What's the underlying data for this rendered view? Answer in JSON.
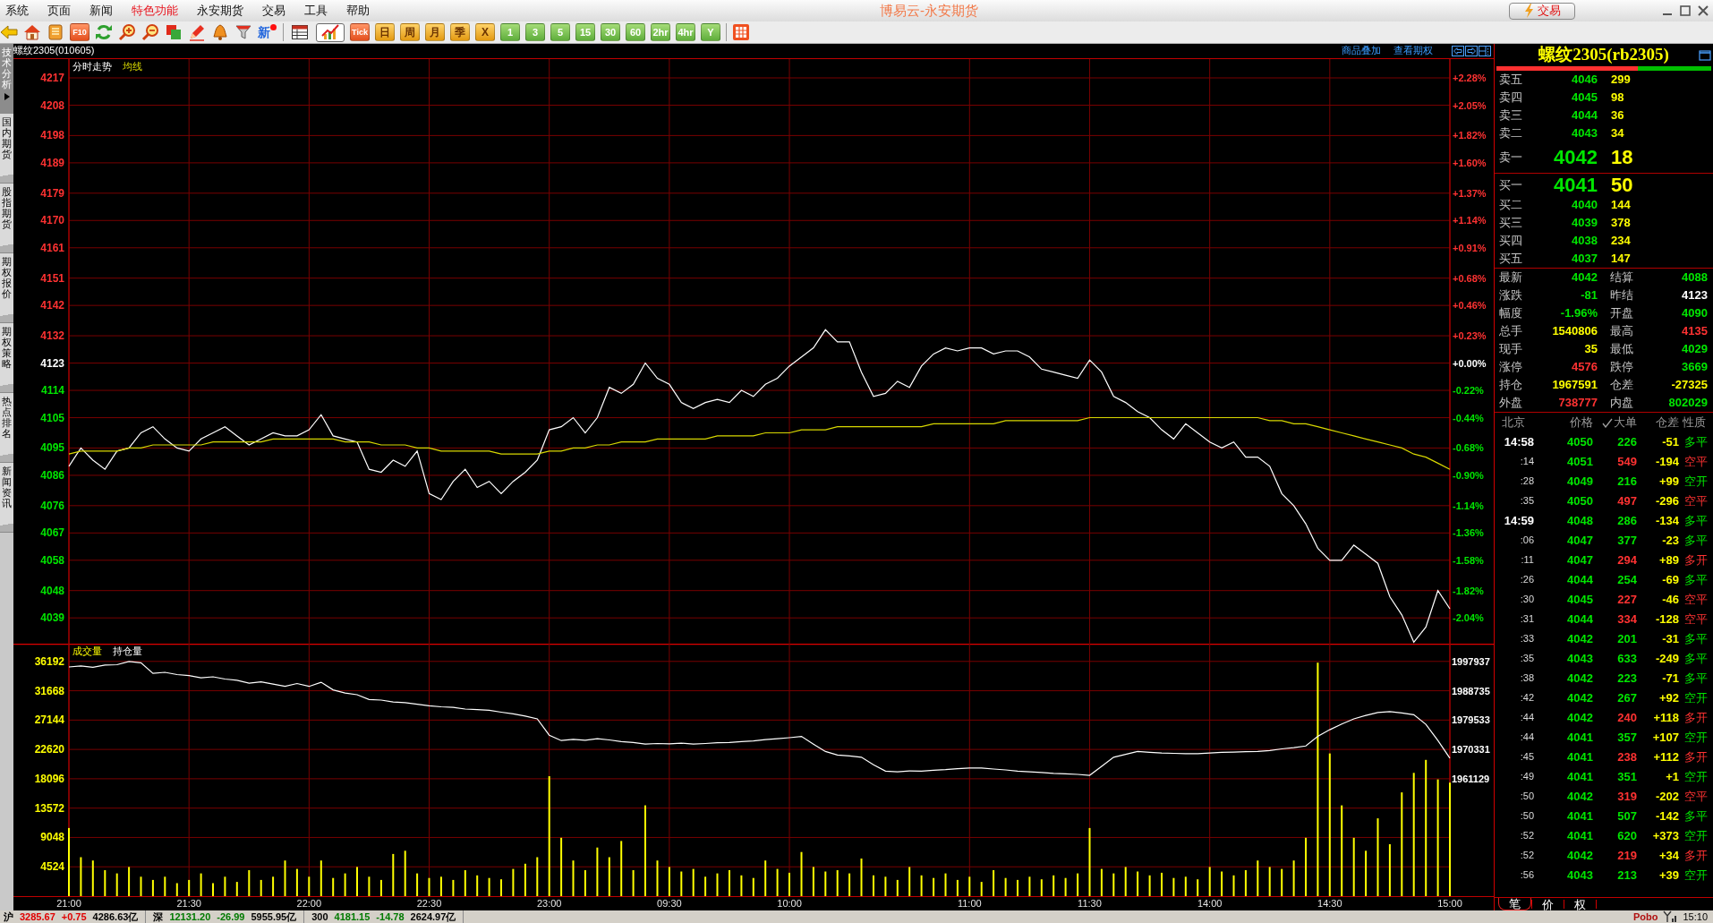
{
  "window": {
    "title": "博易云-永安期货"
  },
  "menu": [
    {
      "label": "系统",
      "highlighted": false
    },
    {
      "label": "页面",
      "highlighted": false
    },
    {
      "label": "新闻",
      "highlighted": false
    },
    {
      "label": "特色功能",
      "highlighted": true
    },
    {
      "label": "永安期货",
      "highlighted": false
    },
    {
      "label": "交易",
      "highlighted": false
    },
    {
      "label": "工具",
      "highlighted": false
    },
    {
      "label": "帮助",
      "highlighted": false
    }
  ],
  "title_buttons": [
    {
      "label": "交易"
    }
  ],
  "toolbar": {
    "f10": "F10",
    "news": {
      "label": "新",
      "badge": true
    },
    "views": [
      {
        "selected": false
      },
      {
        "selected": true
      }
    ],
    "periods": [
      {
        "label": "Tick",
        "kind": "tick"
      },
      {
        "label": "日",
        "kind": "day"
      },
      {
        "label": "周",
        "kind": "day"
      },
      {
        "label": "月",
        "kind": "day"
      },
      {
        "label": "季",
        "kind": "day"
      },
      {
        "label": "X",
        "kind": "day"
      },
      {
        "label": "1",
        "kind": "minute"
      },
      {
        "label": "3",
        "kind": "minute"
      },
      {
        "label": "5",
        "kind": "minute"
      },
      {
        "label": "15",
        "kind": "minute"
      },
      {
        "label": "30",
        "kind": "minute"
      },
      {
        "label": "60",
        "kind": "minute"
      },
      {
        "label": "2hr",
        "kind": "minute"
      },
      {
        "label": "4hr",
        "kind": "minute"
      },
      {
        "label": "Y",
        "kind": "minute"
      }
    ]
  },
  "side_tabs": [
    {
      "label": "技术分析",
      "selected": true
    },
    {
      "label": "国内期货",
      "selected": false
    },
    {
      "label": "股指期货",
      "selected": false
    },
    {
      "label": "期权报价",
      "selected": false
    },
    {
      "label": "期权策略",
      "selected": false
    },
    {
      "label": "热点排名",
      "selected": false
    },
    {
      "label": "新闻资讯",
      "selected": false
    }
  ],
  "chart_header": {
    "title": "螺纹2305(010605)",
    "links": [
      "商品叠加",
      "查看期权"
    ]
  },
  "price_panel": {
    "axis_right": [
      {
        "text": "+2.28%",
        "color": "#ff3232"
      },
      {
        "text": "+2.05%",
        "color": "#ff3232"
      },
      {
        "text": "+1.82%",
        "color": "#ff3232"
      },
      {
        "text": "+1.60%",
        "color": "#ff3232"
      },
      {
        "text": "+1.37%",
        "color": "#ff3232"
      },
      {
        "text": "+1.14%",
        "color": "#ff3232"
      },
      {
        "text": "+0.91%",
        "color": "#ff3232"
      },
      {
        "text": "+0.68%",
        "color": "#ff3232"
      },
      {
        "text": "+0.46%",
        "color": "#ff3232"
      },
      {
        "text": "+0.23%",
        "color": "#ff3232"
      },
      {
        "text": "+0.00%",
        "color": "#ffffff"
      },
      {
        "text": "-0.22%",
        "color": "#00e600"
      },
      {
        "text": "-0.44%",
        "color": "#00e600"
      },
      {
        "text": "-0.68%",
        "color": "#00e600"
      },
      {
        "text": "-0.90%",
        "color": "#00e600"
      },
      {
        "text": "-1.14%",
        "color": "#00e600"
      },
      {
        "text": "-1.36%",
        "color": "#00e600"
      },
      {
        "text": "-1.58%",
        "color": "#00e600"
      },
      {
        "text": "-1.82%",
        "color": "#00e600"
      },
      {
        "text": "-2.04%",
        "color": "#00e600"
      }
    ],
    "chart_data": {
      "type": "line",
      "grid": true,
      "categories": [
        null,
        null,
        null,
        null,
        null,
        null,
        null,
        null,
        null,
        null,
        null,
        null,
        null,
        null,
        null,
        null,
        null,
        null,
        null,
        null,
        null,
        null,
        null,
        null,
        null,
        null,
        null,
        null,
        null,
        null,
        null,
        null,
        null,
        null,
        null,
        null,
        null,
        null,
        null,
        null,
        null,
        null,
        null,
        null,
        null,
        null,
        null,
        null,
        null,
        null,
        null,
        null,
        null,
        null,
        null,
        null,
        null,
        null,
        null,
        null,
        null,
        null,
        null,
        null,
        null,
        null,
        null,
        null,
        null,
        null,
        null,
        null,
        null,
        null,
        null,
        null,
        null,
        null,
        null,
        null,
        null,
        null,
        null,
        null,
        null,
        null,
        null,
        null,
        null,
        null,
        null,
        null,
        null,
        null,
        null,
        null,
        null,
        null,
        null,
        null,
        null,
        null,
        null,
        null,
        null,
        null,
        null,
        null,
        null,
        null,
        null,
        null,
        null,
        null,
        null,
        null
      ],
      "series": [
        {
          "name": "分时走势",
          "color": "#ffffff",
          "values": [
            4089,
            4095,
            4091,
            4088,
            4094,
            4095,
            4100,
            4102,
            4098,
            4095,
            4094,
            4098,
            4100,
            4102,
            4099,
            4096,
            4098,
            4100,
            4099,
            4099,
            4101,
            4106,
            4099,
            4098,
            4097,
            4088,
            4087,
            4091,
            4089,
            4094,
            4080,
            4078,
            4084,
            4088,
            4082,
            4084,
            4080,
            4084,
            4087,
            4091,
            4101,
            4102,
            4105,
            4100,
            4105,
            4115,
            4113,
            4116,
            4123,
            4118,
            4116,
            4110,
            4108,
            4110,
            4111,
            4110,
            4114,
            4112,
            4116,
            4118,
            4122,
            4125,
            4128,
            4134,
            4130,
            4130,
            4120,
            4112,
            4113,
            4117,
            4115,
            4122,
            4126,
            4128,
            4127,
            4128,
            4128,
            4126,
            4127,
            4127,
            4125,
            4121,
            4120,
            4119,
            4118,
            4124,
            4120,
            4112,
            4110,
            4107,
            4105,
            4101,
            4098,
            4103,
            4100,
            4097,
            4095,
            4097,
            4092,
            4092,
            4089,
            4080,
            4076,
            4070,
            4062,
            4058,
            4058,
            4063,
            4060,
            4057,
            4046,
            4040,
            4031,
            4036,
            4048,
            4042
          ]
        },
        {
          "name": "均线",
          "color": "#d8d800",
          "values": [
            4093,
            4094,
            4094,
            4094,
            4094,
            4095,
            4095,
            4096,
            4096,
            4096,
            4096,
            4096,
            4097,
            4097,
            4097,
            4097,
            4097,
            4098,
            4098,
            4098,
            4098,
            4098,
            4098,
            4097,
            4097,
            4097,
            4096,
            4096,
            4096,
            4095,
            4095,
            4094,
            4094,
            4094,
            4094,
            4094,
            4093,
            4093,
            4093,
            4093,
            4094,
            4094,
            4095,
            4095,
            4096,
            4096,
            4097,
            4097,
            4097,
            4098,
            4098,
            4098,
            4098,
            4098,
            4099,
            4099,
            4099,
            4099,
            4100,
            4100,
            4100,
            4101,
            4101,
            4101,
            4102,
            4102,
            4102,
            4102,
            4102,
            4102,
            4102,
            4102,
            4103,
            4103,
            4103,
            4103,
            4103,
            4103,
            4104,
            4104,
            4104,
            4104,
            4104,
            4104,
            4104,
            4105,
            4105,
            4105,
            4105,
            4105,
            4105,
            4105,
            4105,
            4105,
            4105,
            4105,
            4105,
            4105,
            4105,
            4105,
            4104,
            4104,
            4103,
            4103,
            4102,
            4101,
            4100,
            4099,
            4098,
            4097,
            4096,
            4095,
            4093,
            4092,
            4090,
            4088
          ]
        }
      ],
      "ylim": [
        4030.5,
        4223.2
      ],
      "yticks": [
        {
          "value": 4217,
          "label": "4217"
        },
        {
          "value": 4208,
          "label": "4208"
        },
        {
          "value": 4198,
          "label": "4198"
        },
        {
          "value": 4189,
          "label": "4189"
        },
        {
          "value": 4179,
          "label": "4179"
        },
        {
          "value": 4170,
          "label": "4170"
        },
        {
          "value": 4161,
          "label": "4161"
        },
        {
          "value": 4151,
          "label": "4151"
        },
        {
          "value": 4142,
          "label": "4142"
        },
        {
          "value": 4132,
          "label": "4132"
        },
        {
          "value": 4123,
          "label": "4123"
        },
        {
          "value": 4114,
          "label": "4114"
        },
        {
          "value": 4105,
          "label": "4105"
        },
        {
          "value": 4095,
          "label": "4095"
        },
        {
          "value": 4086,
          "label": "4086"
        },
        {
          "value": 4076,
          "label": "4076"
        },
        {
          "value": 4067,
          "label": "4067"
        },
        {
          "value": 4058,
          "label": "4058"
        },
        {
          "value": 4048,
          "label": "4048"
        },
        {
          "value": 4039,
          "label": "4039"
        }
      ]
    }
  },
  "volume_panel": {
    "chart_data": {
      "type": "bar",
      "grid": true,
      "categories": [
        "21:00",
        null,
        null,
        null,
        null,
        null,
        null,
        null,
        null,
        null,
        "21:30",
        null,
        null,
        null,
        null,
        null,
        null,
        null,
        null,
        null,
        "22:00",
        null,
        null,
        null,
        null,
        null,
        null,
        null,
        null,
        null,
        "22:30",
        null,
        null,
        null,
        null,
        null,
        null,
        null,
        null,
        null,
        "23:00",
        null,
        null,
        null,
        null,
        null,
        null,
        null,
        null,
        null,
        "09:30",
        null,
        null,
        null,
        null,
        null,
        null,
        null,
        null,
        null,
        "10:00",
        null,
        null,
        null,
        null,
        null,
        null,
        null,
        null,
        null,
        null,
        null,
        null,
        null,
        null,
        "11:00",
        null,
        null,
        null,
        null,
        null,
        null,
        null,
        null,
        null,
        "11:30",
        null,
        null,
        null,
        null,
        null,
        null,
        null,
        null,
        null,
        "14:00",
        null,
        null,
        null,
        null,
        null,
        null,
        null,
        null,
        null,
        "14:30",
        null,
        null,
        null,
        null,
        null,
        null,
        null,
        null,
        null,
        "15:00"
      ],
      "series": [
        {
          "name": "成交量",
          "color": "#ffff00",
          "values": [
            10500,
            6000,
            5500,
            4000,
            3500,
            4500,
            3000,
            2500,
            3000,
            2000,
            2500,
            3500,
            2000,
            3000,
            2200,
            4000,
            2500,
            3000,
            5500,
            4200,
            3000,
            5500,
            2800,
            3500,
            4500,
            3000,
            2500,
            6500,
            7000,
            3500,
            2800,
            3000,
            2500,
            4000,
            3200,
            2800,
            2600,
            4200,
            5000,
            6000,
            18500,
            9000,
            5500,
            4000,
            7500,
            6000,
            8500,
            4000,
            14000,
            5500,
            4500,
            3800,
            4200,
            3000,
            3500,
            4000,
            3200,
            2800,
            5500,
            4200,
            3600,
            6800,
            4500,
            3800,
            4000,
            3500,
            5800,
            3200,
            3000,
            2500,
            4500,
            3200,
            2800,
            3500,
            2500,
            3000,
            2200,
            4000,
            2800,
            2500,
            3000,
            2600,
            3200,
            2800,
            3500,
            10500,
            4200,
            3500,
            4500,
            3800,
            3200,
            3600,
            2800,
            3000,
            2600,
            4500,
            3800,
            3200,
            4000,
            5500,
            4500,
            4200,
            5500,
            9000,
            36000,
            22000,
            14000,
            9000,
            7000,
            12000,
            8000,
            16000,
            19000,
            21000,
            18000,
            17500
          ]
        }
      ],
      "ylim": [
        0,
        38922
      ],
      "yticks": [
        {
          "value": 36192,
          "label": "36192"
        },
        {
          "value": 31668,
          "label": "31668"
        },
        {
          "value": 27144,
          "label": "27144"
        },
        {
          "value": 22620,
          "label": "22620"
        },
        {
          "value": 18096,
          "label": "18096"
        },
        {
          "value": 13572,
          "label": "13572"
        },
        {
          "value": 9048,
          "label": "9048"
        },
        {
          "value": 4524,
          "label": "4524"
        }
      ]
    },
    "open_interest": {
      "chart_data": {
        "type": "line",
        "categories": [
          null,
          null,
          null,
          null,
          null,
          null,
          null,
          null,
          null,
          null,
          null,
          null,
          null,
          null,
          null,
          null,
          null,
          null,
          null,
          null,
          null,
          null,
          null,
          null,
          null,
          null,
          null,
          null,
          null,
          null,
          null,
          null,
          null,
          null,
          null,
          null,
          null,
          null,
          null,
          null,
          null,
          null,
          null,
          null,
          null,
          null,
          null,
          null,
          null,
          null,
          null,
          null,
          null,
          null,
          null,
          null,
          null,
          null,
          null,
          null,
          null,
          null,
          null,
          null,
          null,
          null,
          null,
          null,
          null,
          null,
          null,
          null,
          null,
          null,
          null,
          null,
          null,
          null,
          null,
          null,
          null,
          null,
          null,
          null,
          null,
          null,
          null,
          null,
          null,
          null,
          null,
          null,
          null,
          null,
          null,
          null,
          null,
          null,
          null,
          null,
          null,
          null,
          null,
          null,
          null,
          null,
          null,
          null,
          null,
          null,
          null,
          null,
          null,
          null,
          null,
          null
        ],
        "series": [
          {
            "name": "持仓量",
            "color": "#ffffff",
            "values": [
              1996200,
              1996500,
              1996100,
              1996800,
              1996900,
              1997900,
              1997500,
              1994200,
              1994500,
              1993800,
              1993500,
              1992800,
              1993100,
              1992400,
              1992000,
              1991100,
              1991500,
              1990800,
              1990100,
              1991000,
              1990100,
              1991400,
              1989000,
              1988000,
              1987500,
              1986000,
              1985800,
              1985200,
              1985000,
              1984500,
              1984000,
              1983700,
              1983500,
              1983000,
              1982800,
              1982600,
              1982000,
              1981500,
              1980800,
              1979900,
              1974800,
              1973100,
              1973500,
              1973200,
              1973700,
              1973300,
              1972800,
              1972500,
              1972000,
              1972200,
              1972100,
              1972300,
              1972000,
              1972200,
              1972400,
              1972500,
              1972800,
              1973000,
              1973400,
              1973700,
              1974000,
              1974400,
              1972000,
              1969700,
              1968600,
              1968300,
              1967900,
              1965500,
              1963500,
              1963300,
              1963600,
              1963500,
              1963800,
              1964000,
              1964300,
              1964500,
              1964500,
              1964200,
              1963900,
              1963500,
              1963300,
              1963100,
              1962800,
              1962700,
              1962500,
              1962200,
              1965000,
              1967900,
              1968800,
              1969700,
              1969400,
              1969200,
              1969100,
              1969000,
              1969000,
              1969200,
              1969400,
              1969500,
              1969600,
              1969700,
              1970000,
              1970500,
              1970900,
              1971400,
              1974400,
              1976500,
              1978300,
              1979900,
              1981000,
              1981900,
              1982200,
              1981800,
              1981200,
              1978200,
              1973100,
              1967600
            ]
          }
        ],
        "ylim": [
          1961129,
          1997937
        ],
        "yticks": [
          {
            "value": 1997937,
            "label": "1997937"
          },
          {
            "value": 1988735,
            "label": "1988735"
          },
          {
            "value": 1979533,
            "label": "1979533"
          },
          {
            "value": 1970331,
            "label": "1970331"
          },
          {
            "value": 1961129,
            "label": "1961129"
          }
        ]
      }
    }
  },
  "quote": {
    "title": "螺纹2305(rb2305)",
    "buy_ratio": {
      "level": 0.66
    },
    "asks": [
      {
        "label": "卖五",
        "price": "4046",
        "volume": "299",
        "kind": "level"
      },
      {
        "label": "卖四",
        "price": "4045",
        "volume": "98",
        "kind": "level"
      },
      {
        "label": "卖三",
        "price": "4044",
        "volume": "36",
        "kind": "level"
      },
      {
        "label": "卖二",
        "price": "4043",
        "volume": "34",
        "kind": "level"
      },
      {
        "label": "卖一",
        "price": "4042",
        "volume": "18",
        "kind": "best"
      }
    ],
    "bids": [
      {
        "label": "买一",
        "price": "4041",
        "volume": "50",
        "kind": "best"
      },
      {
        "label": "买二",
        "price": "4040",
        "volume": "144",
        "kind": "level"
      },
      {
        "label": "买三",
        "price": "4039",
        "volume": "378",
        "kind": "level"
      },
      {
        "label": "买四",
        "price": "4038",
        "volume": "234",
        "kind": "level"
      },
      {
        "label": "买五",
        "price": "4037",
        "volume": "147",
        "kind": "level"
      }
    ],
    "stats": [
      {
        "label": "最新",
        "value": "4042",
        "color": "#00e600"
      },
      {
        "label": "结算",
        "value": "4088",
        "color": "#00e600"
      },
      {
        "label": "涨跌",
        "value": "-81",
        "color": "#00e600"
      },
      {
        "label": "昨结",
        "value": "4123",
        "color": "#ffffff"
      },
      {
        "label": "幅度",
        "value": "-1.96%",
        "color": "#00e600"
      },
      {
        "label": "开盘",
        "value": "4090",
        "color": "#00e600"
      },
      {
        "label": "总手",
        "value": "1540806",
        "color": "#ffff00"
      },
      {
        "label": "最高",
        "value": "4135",
        "color": "#ff3232"
      },
      {
        "label": "现手",
        "value": "35",
        "color": "#ffff00"
      },
      {
        "label": "最低",
        "value": "4029",
        "color": "#00e600"
      },
      {
        "label": "涨停",
        "value": "4576",
        "color": "#ff3232"
      },
      {
        "label": "跌停",
        "value": "3669",
        "color": "#00e600"
      },
      {
        "label": "持仓",
        "value": "1967591",
        "color": "#ffff00"
      },
      {
        "label": "仓差",
        "value": "-27325",
        "color": "#ffff00"
      },
      {
        "label": "外盘",
        "value": "738777",
        "color": "#ff3232"
      },
      {
        "label": "内盘",
        "value": "802029",
        "color": "#00e600"
      }
    ]
  },
  "trades": {
    "columns": [
      {
        "label": "北京"
      },
      {
        "label": "价格"
      },
      {
        "label": "大单",
        "checked": true
      },
      {
        "label": "仓差"
      },
      {
        "label": "性质"
      }
    ],
    "rows": [
      {
        "time": "14:58",
        "kind": "minute",
        "price": "4050",
        "volume": "226",
        "change": "-51",
        "nature": "多平",
        "color": "#00e600"
      },
      {
        "time": ":14",
        "kind": "second",
        "price": "4051",
        "volume": "549",
        "change": "-194",
        "nature": "空平",
        "color": "#ff3232"
      },
      {
        "time": ":28",
        "kind": "second",
        "price": "4049",
        "volume": "216",
        "change": "+99",
        "nature": "空开",
        "color": "#00e600"
      },
      {
        "time": ":35",
        "kind": "second",
        "price": "4050",
        "volume": "497",
        "change": "-296",
        "nature": "空平",
        "color": "#ff3232"
      },
      {
        "time": "14:59",
        "kind": "minute",
        "price": "4048",
        "volume": "286",
        "change": "-134",
        "nature": "多平",
        "color": "#00e600"
      },
      {
        "time": ":06",
        "kind": "second",
        "price": "4047",
        "volume": "377",
        "change": "-23",
        "nature": "多平",
        "color": "#00e600"
      },
      {
        "time": ":11",
        "kind": "second",
        "price": "4047",
        "volume": "294",
        "change": "+89",
        "nature": "多开",
        "color": "#ff3232"
      },
      {
        "time": ":26",
        "kind": "second",
        "price": "4044",
        "volume": "254",
        "change": "-69",
        "nature": "多平",
        "color": "#00e600"
      },
      {
        "time": ":30",
        "kind": "second",
        "price": "4045",
        "volume": "227",
        "change": "-46",
        "nature": "空平",
        "color": "#ff3232"
      },
      {
        "time": ":31",
        "kind": "second",
        "price": "4044",
        "volume": "334",
        "change": "-128",
        "nature": "空平",
        "color": "#ff3232"
      },
      {
        "time": ":33",
        "kind": "second",
        "price": "4042",
        "volume": "201",
        "change": "-31",
        "nature": "多平",
        "color": "#00e600"
      },
      {
        "time": ":35",
        "kind": "second",
        "price": "4043",
        "volume": "633",
        "change": "-249",
        "nature": "多平",
        "color": "#00e600"
      },
      {
        "time": ":38",
        "kind": "second",
        "price": "4042",
        "volume": "223",
        "change": "-71",
        "nature": "多平",
        "color": "#00e600"
      },
      {
        "time": ":42",
        "kind": "second",
        "price": "4042",
        "volume": "267",
        "change": "+92",
        "nature": "空开",
        "color": "#00e600"
      },
      {
        "time": ":44",
        "kind": "second",
        "price": "4042",
        "volume": "240",
        "change": "+118",
        "nature": "多开",
        "color": "#ff3232"
      },
      {
        "time": ":44",
        "kind": "second",
        "price": "4041",
        "volume": "357",
        "change": "+107",
        "nature": "空开",
        "color": "#00e600"
      },
      {
        "time": ":45",
        "kind": "second",
        "price": "4041",
        "volume": "238",
        "change": "+112",
        "nature": "多开",
        "color": "#ff3232"
      },
      {
        "time": ":49",
        "kind": "second",
        "price": "4041",
        "volume": "351",
        "change": "+1",
        "nature": "空开",
        "color": "#00e600"
      },
      {
        "time": ":50",
        "kind": "second",
        "price": "4042",
        "volume": "319",
        "change": "-202",
        "nature": "空平",
        "color": "#ff3232"
      },
      {
        "time": ":50",
        "kind": "second",
        "price": "4041",
        "volume": "507",
        "change": "-142",
        "nature": "多平",
        "color": "#00e600"
      },
      {
        "time": ":52",
        "kind": "second",
        "price": "4041",
        "volume": "620",
        "change": "+373",
        "nature": "空开",
        "color": "#00e600"
      },
      {
        "time": ":52",
        "kind": "second",
        "price": "4042",
        "volume": "219",
        "change": "+34",
        "nature": "多开",
        "color": "#ff3232"
      },
      {
        "time": ":56",
        "kind": "second",
        "price": "4043",
        "volume": "213",
        "change": "+39",
        "nature": "空开",
        "color": "#00e600"
      }
    ],
    "tabs": [
      {
        "label": "笔",
        "selected": true
      },
      {
        "label": "价",
        "selected": false
      },
      {
        "label": "权",
        "selected": false
      }
    ]
  },
  "status_bar": {
    "groups": [
      [
        {
          "text": "沪",
          "color": "#000000"
        },
        {
          "text": "3285.67",
          "color": "#e00000"
        },
        {
          "text": "+0.75",
          "color": "#e00000"
        },
        {
          "text": "4286.63亿",
          "color": "#000000"
        }
      ],
      [
        {
          "text": "深",
          "color": "#000000"
        },
        {
          "text": "12131.20",
          "color": "#007a00"
        },
        {
          "text": "-26.99",
          "color": "#007a00"
        },
        {
          "text": "5955.95亿",
          "color": "#000000"
        }
      ],
      [
        {
          "text": "300",
          "color": "#000000"
        },
        {
          "text": "4181.15",
          "color": "#007a00"
        },
        {
          "text": "-14.78",
          "color": "#007a00"
        },
        {
          "text": "2624.97亿",
          "color": "#000000"
        }
      ]
    ],
    "brand": "Pobo",
    "clock": "15:10"
  }
}
